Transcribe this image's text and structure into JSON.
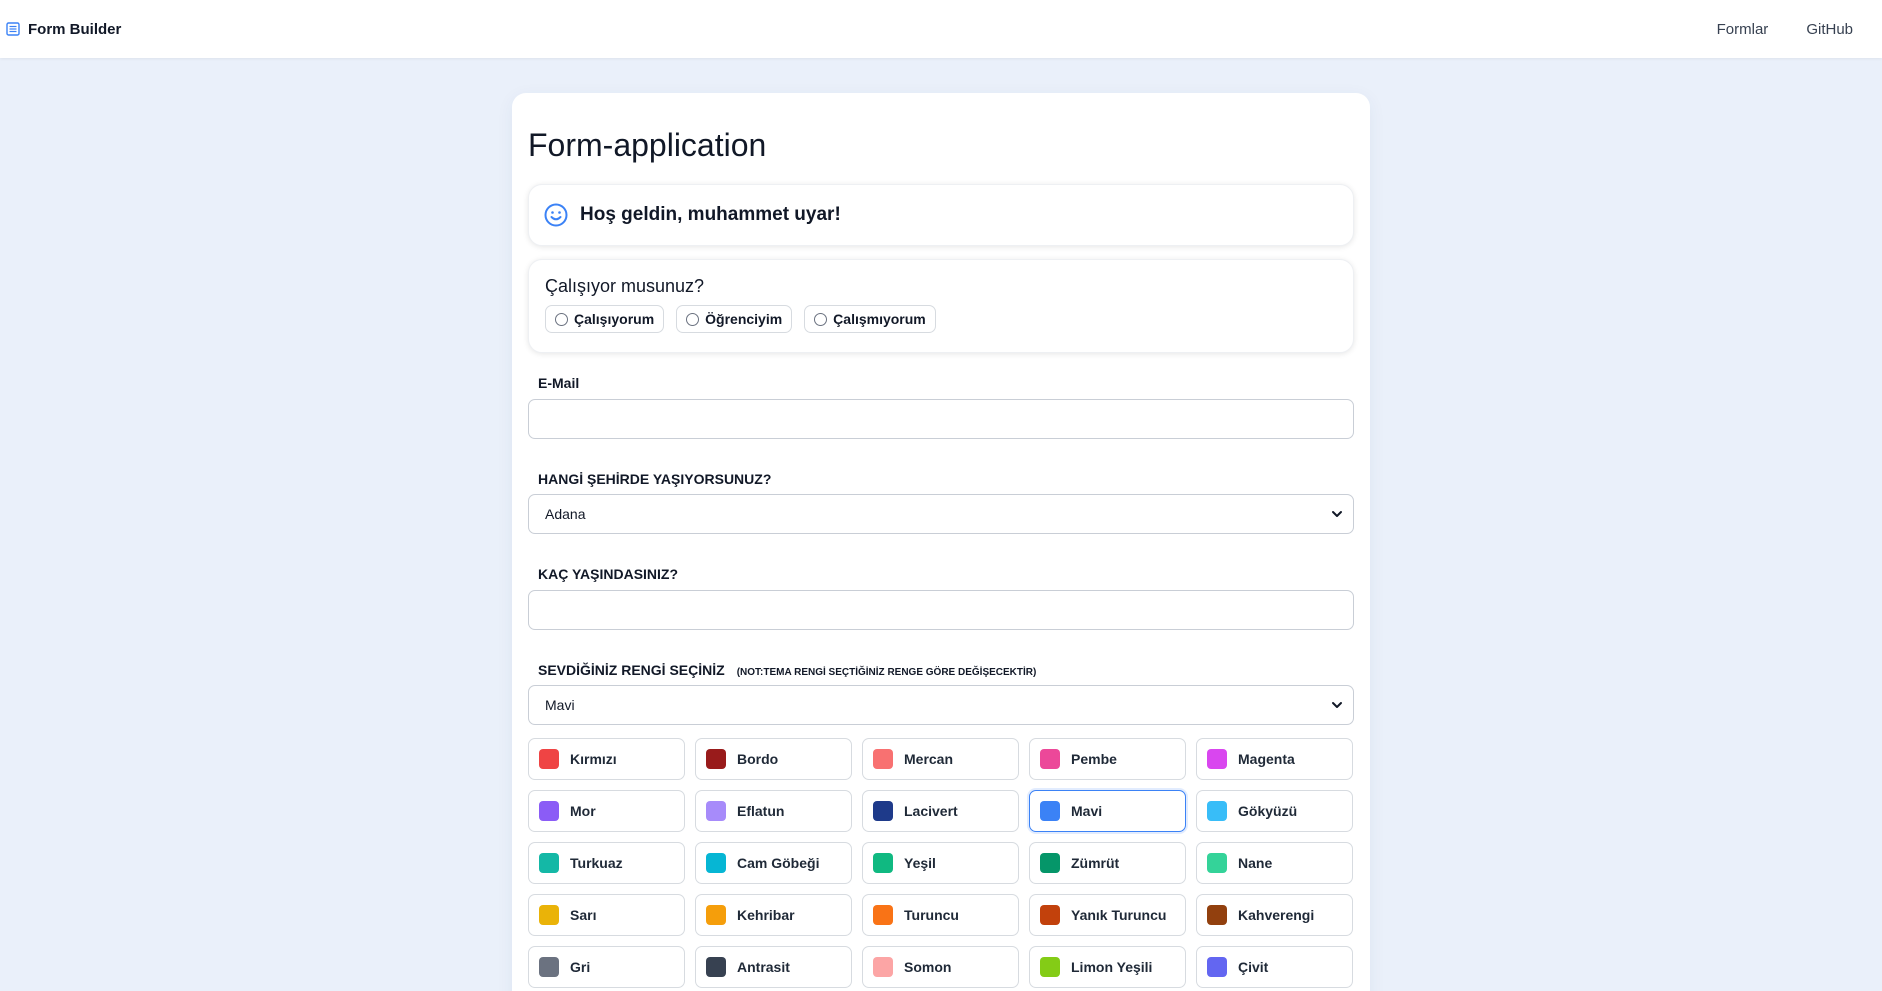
{
  "navbar": {
    "brand": "Form Builder",
    "brand_icon": "form-icon",
    "links": [
      "Formlar",
      "GitHub"
    ]
  },
  "form": {
    "title": "Form-application",
    "welcome": "Hoş geldin, muhammet uyar!",
    "welcome_icon": "smile-icon",
    "employment": {
      "question": "Çalışıyor musunuz?",
      "options": [
        "Çalışıyorum",
        "Öğrenciyim",
        "Çalışmıyorum"
      ]
    },
    "email": {
      "label": "E-Mail",
      "value": ""
    },
    "city": {
      "label": "HANGİ ŞEHİRDE YAŞIYORSUNUZ?",
      "selected": "Adana"
    },
    "age": {
      "label": "KAÇ YAŞINDASINIZ?",
      "value": ""
    },
    "color": {
      "label": "SEVDİĞİNİZ RENGİ SEÇİNİZ",
      "note": "(NOT:TEMA RENGİ SEÇTİĞİNİZ RENGE GÖRE DEĞİŞECEKTİR)",
      "selected": "Mavi",
      "options": [
        {
          "name": "Kırmızı",
          "color": "#ef4444"
        },
        {
          "name": "Bordo",
          "color": "#991b1b"
        },
        {
          "name": "Mercan",
          "color": "#f87171"
        },
        {
          "name": "Pembe",
          "color": "#ec4899"
        },
        {
          "name": "Magenta",
          "color": "#d946ef"
        },
        {
          "name": "Mor",
          "color": "#8b5cf6"
        },
        {
          "name": "Eflatun",
          "color": "#a78bfa"
        },
        {
          "name": "Lacivert",
          "color": "#1e3a8a"
        },
        {
          "name": "Mavi",
          "color": "#3b82f6"
        },
        {
          "name": "Gökyüzü",
          "color": "#38bdf8"
        },
        {
          "name": "Turkuaz",
          "color": "#14b8a6"
        },
        {
          "name": "Cam Göbeği",
          "color": "#06b6d4"
        },
        {
          "name": "Yeşil",
          "color": "#10b981"
        },
        {
          "name": "Zümrüt",
          "color": "#059669"
        },
        {
          "name": "Nane",
          "color": "#34d399"
        },
        {
          "name": "Sarı",
          "color": "#eab308"
        },
        {
          "name": "Kehribar",
          "color": "#f59e0b"
        },
        {
          "name": "Turuncu",
          "color": "#f97316"
        },
        {
          "name": "Yanık Turuncu",
          "color": "#c2410c"
        },
        {
          "name": "Kahverengi",
          "color": "#92400e"
        },
        {
          "name": "Gri",
          "color": "#6b7280"
        },
        {
          "name": "Antrasit",
          "color": "#374151"
        },
        {
          "name": "Somon",
          "color": "#fca5a5"
        },
        {
          "name": "Limon Yeşili",
          "color": "#84cc16"
        },
        {
          "name": "Çivit",
          "color": "#6366f1"
        }
      ]
    }
  },
  "theme": {
    "accent": "#3b82f6",
    "background": "#eaf0fa"
  }
}
